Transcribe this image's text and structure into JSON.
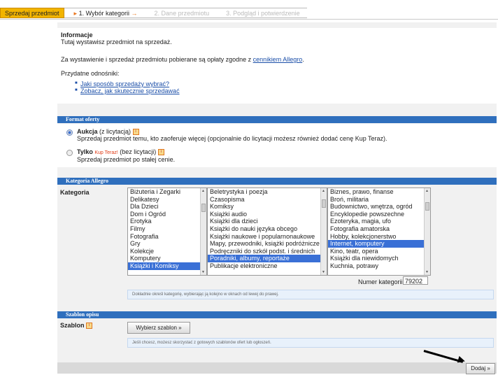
{
  "wizard": {
    "first": "Sprzedaj przedmiot",
    "step1": "1. Wybór kategorii",
    "step2": "2. Dane przedmiotu",
    "step3": "3. Podgląd i potwierdzenie"
  },
  "info": {
    "heading": "Informacje",
    "line1": "Tutaj wystawisz przedmiot na sprzedaż.",
    "line2_prefix": "Za wystawienie i sprzedaż przedmiotu pobierane są opłaty zgodne z",
    "line2_link": "cennikiem Allegro",
    "line2_suffix": ".",
    "useful": "Przydatne odnośniki:",
    "link1": "Jaki sposób sprzedaży wybrać?",
    "link2": "Zobacz, jak skutecznie sprzedawać"
  },
  "format": {
    "header": "Format oferty",
    "auction_title": "Aukcja",
    "auction_note": "(z licytacją)",
    "auction_desc": "Sprzedaj przedmiot temu, kto zaoferuje więcej (opcjonalnie do licytacji możesz również dodać cenę Kup Teraz).",
    "only_title": "Tylko",
    "kup_teraz": "Kup Teraz!",
    "only_note": "(bez licytacji)",
    "only_desc": "Sprzedaj przedmiot po stałej cenie."
  },
  "category": {
    "header": "Kategoria Allegro",
    "label": "Kategoria",
    "list1": [
      "Biżuteria i Zegarki",
      "Delikatesy",
      "Dla Dzieci",
      "Dom i Ogród",
      "Erotyka",
      "Filmy",
      "Fotografia",
      "Gry",
      "Kolekcje",
      "Komputery",
      "Książki i Komiksy"
    ],
    "list1_selected": 10,
    "list2": [
      "Beletrystyka i poezja",
      "Czasopisma",
      "Komiksy",
      "Książki audio",
      "Książki dla dzieci",
      "Książki do nauki języka obcego",
      "Książki naukowe i popularnonaukowe",
      "Mapy, przewodniki, książki podróżnicze",
      "Podręczniki do szkół podst. i średnich",
      "Poradniki, albumy, reportaże",
      "Publikacje elektroniczne"
    ],
    "list2_selected": 9,
    "list3": [
      "Biznes, prawo, finanse",
      "Broń, militaria",
      "Budownictwo, wnętrza, ogród",
      "Encyklopedie powszechne",
      "Ezoteryka, magia, ufo",
      "Fotografia amatorska",
      "Hobby, kolekcjonerstwo",
      "Internet, komputery",
      "Kino, teatr, opera",
      "Książki dla niewidomych",
      "Kuchnia, potrawy"
    ],
    "list3_selected": 7,
    "number_label": "Numer kategorii",
    "number_value": "79202",
    "hint": "Dokładnie określ kategorię, wybierając ją kolejno w oknach od lewej do prawej."
  },
  "template": {
    "header": "Szablon opisu",
    "label": "Szablon",
    "button": "Wybierz szablon »",
    "hint": "Jeśli chcesz, możesz skorzystać z gotowych szablonów ofert lub ogłoszeń."
  },
  "footer": {
    "add_button": "Dodaj »"
  },
  "colors": {
    "accent": "#f2b400",
    "header_blue": "#2f6fbd",
    "selection": "#3a70d6",
    "link": "#1a4ea8"
  }
}
